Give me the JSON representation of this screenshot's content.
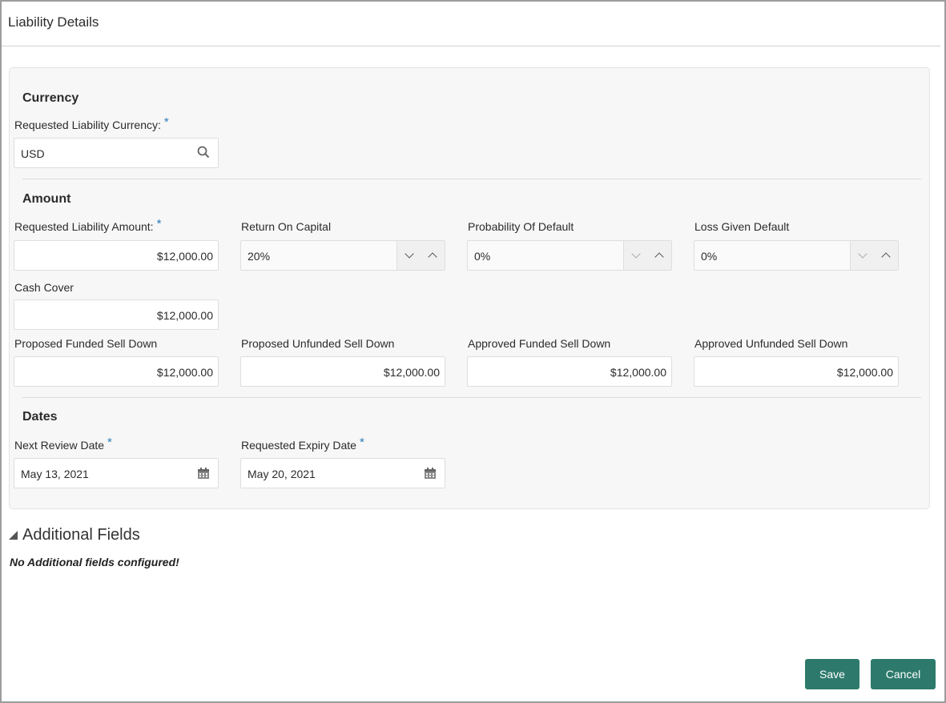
{
  "header": {
    "title": "Liability Details"
  },
  "currency": {
    "section_title": "Currency",
    "requested_label": "Requested Liability Currency:",
    "requested_value": "USD",
    "required_mark": "*"
  },
  "amount": {
    "section_title": "Amount",
    "requested_amount_label": "Requested Liability Amount:",
    "requested_amount_value": "$12,000.00",
    "return_on_capital_label": "Return On Capital",
    "return_on_capital_value": "20%",
    "probability_default_label": "Probability Of Default",
    "probability_default_value": "0%",
    "loss_given_default_label": "Loss Given Default",
    "loss_given_default_value": "0%",
    "cash_cover_label": "Cash Cover",
    "cash_cover_value": "$12,000.00",
    "proposed_funded_label": "Proposed Funded Sell Down",
    "proposed_funded_value": "$12,000.00",
    "proposed_unfunded_label": "Proposed Unfunded Sell Down",
    "proposed_unfunded_value": "$12,000.00",
    "approved_funded_label": "Approved Funded Sell Down",
    "approved_funded_value": "$12,000.00",
    "approved_unfunded_label": "Approved Unfunded Sell Down",
    "approved_unfunded_value": "$12,000.00"
  },
  "dates": {
    "section_title": "Dates",
    "next_review_label": "Next Review Date",
    "next_review_value": "May 13, 2021",
    "expiry_label": "Requested Expiry Date",
    "expiry_value": "May 20, 2021"
  },
  "additional": {
    "title": "Additional Fields",
    "note": "No Additional fields configured!"
  },
  "actions": {
    "save_label": "Save",
    "cancel_label": "Cancel"
  },
  "icons": {
    "search": "search-icon",
    "calendar": "calendar-icon",
    "spin_down": "chevron-down-icon",
    "spin_up": "chevron-up-icon",
    "collapse": "collapse-triangle-icon"
  },
  "colors": {
    "accent": "#2d7a6c",
    "required": "#2e7cb8"
  }
}
